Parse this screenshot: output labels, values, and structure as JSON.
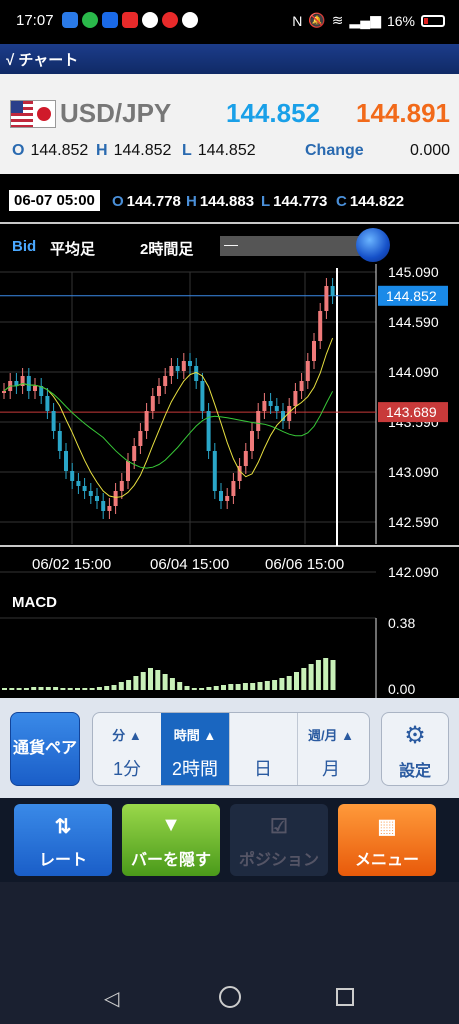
{
  "status": {
    "time": "17:07",
    "battery": "16%"
  },
  "app": {
    "title": "チャート"
  },
  "rate": {
    "pair": "USD/JPY",
    "bid": "144.852",
    "ask": "144.891",
    "open_label": "O",
    "open": "144.852",
    "high_label": "H",
    "high": "144.852",
    "low_label": "L",
    "low": "144.852",
    "change_label": "Change",
    "change": "0.000"
  },
  "candle_info": {
    "date": "06-07 05:00",
    "o_label": "O",
    "o": "144.778",
    "h_label": "H",
    "h": "144.883",
    "l_label": "L",
    "l": "144.773",
    "c_label": "C",
    "c": "144.822"
  },
  "chart": {
    "bid_label": "Bid",
    "type_label": "平均足",
    "period_label": "2時間足",
    "price_ticks": [
      "145.090",
      "144.590",
      "144.090",
      "143.590",
      "143.090",
      "142.590",
      "142.090"
    ],
    "current_price_tag": "144.852",
    "marker_price_tag": "143.689",
    "time_labels": [
      "06/02 15:00",
      "06/04 15:00",
      "06/06 15:00"
    ],
    "macd_label": "MACD",
    "macd_ticks": [
      "0.38",
      "0.00"
    ]
  },
  "colors": {
    "up": "#f07a7a",
    "down": "#2aa6c8",
    "ma_fast": "#e8e040",
    "ma_slow": "#38c838",
    "current_line": "#3a8ae8",
    "marker_line": "#c83a3a"
  },
  "toolbar": {
    "pair_button": "通貨ペア",
    "timeframes": [
      {
        "header": "分",
        "value": "1分"
      },
      {
        "header": "時間",
        "value": "2時間"
      },
      {
        "header": "",
        "value": "日"
      },
      {
        "header": "週/月",
        "value": "月"
      }
    ],
    "settings": "設定"
  },
  "nav": {
    "rate": "レート",
    "hide_bar": "バーを隠す",
    "position": "ポジション",
    "menu": "メニュー"
  }
}
